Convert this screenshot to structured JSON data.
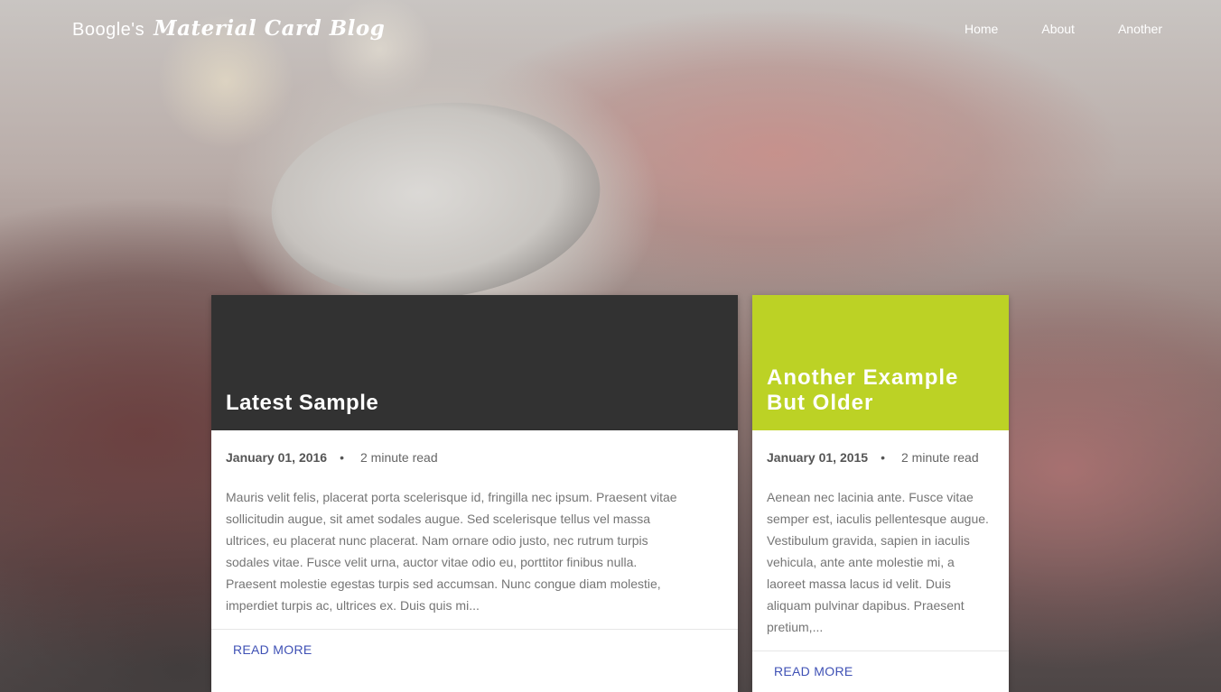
{
  "navbar": {
    "brand_prefix": "Boogle's",
    "brand_name": "Material Card Blog",
    "links": [
      "Home",
      "About",
      "Another"
    ]
  },
  "posts": [
    {
      "title": "Latest Sample",
      "date": "January 01, 2016",
      "separator": "•",
      "read_time": "2 minute read",
      "excerpt": "Mauris velit felis, placerat porta scelerisque id, fringilla nec ipsum. Praesent vitae sollicitudin augue, sit amet sodales augue. Sed scelerisque tellus vel massa ultrices, eu placerat nunc placerat. Nam ornare odio justo, nec rutrum turpis sodales vitae. Fusce velit urna, auctor vitae odio eu, porttitor finibus nulla. Praesent molestie egestas turpis sed accumsan. Nunc congue diam molestie, imperdiet turpis ac, ultrices ex. Duis quis mi...",
      "read_more": "READ MORE",
      "header_color": "#323232"
    },
    {
      "title": "Another Example But Older",
      "date": "January 01, 2015",
      "separator": "•",
      "read_time": "2 minute read",
      "excerpt": "Aenean nec lacinia ante. Fusce vitae semper est, iaculis pellentesque augue. Vestibulum gravida, sapien in iaculis vehicula, ante ante molestie mi, a laoreet massa lacus id velit. Duis aliquam pulvinar dapibus. Praesent pretium,...",
      "read_more": "READ MORE",
      "header_color": "#bcd225"
    }
  ],
  "colors": {
    "link": "#3f51b5",
    "text_muted": "#757575"
  }
}
